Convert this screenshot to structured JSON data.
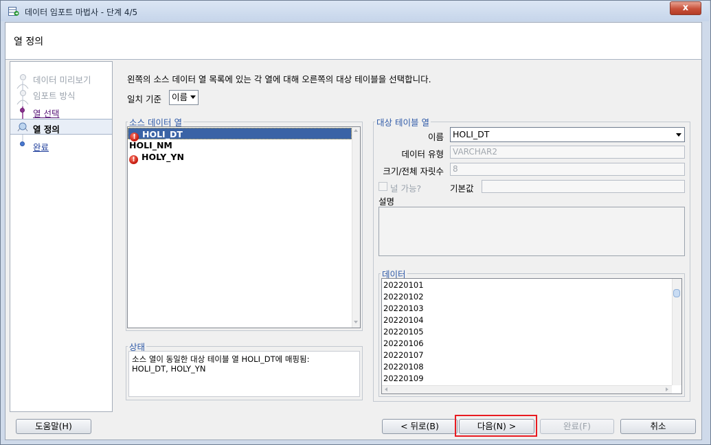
{
  "window": {
    "title": "데이터 임포트 마법사 - 단계 4/5",
    "close_glyph": "x"
  },
  "header": {
    "title": "열 정의"
  },
  "nav": {
    "items": [
      {
        "label": "데이터 미리보기",
        "state": "done"
      },
      {
        "label": "임포트 방식",
        "state": "done"
      },
      {
        "label": "열 선택",
        "state": "link"
      },
      {
        "label": "열 정의",
        "state": "current"
      },
      {
        "label": "완료",
        "state": "link"
      }
    ]
  },
  "main": {
    "instruction": "왼쪽의 소스 데이터 열 목록에 있는 각 열에 대해 오른쪽의 대상 테이블을 선택합니다.",
    "match_label": "일치 기준",
    "match_value": "이름"
  },
  "source": {
    "legend": "소스 데이터 열",
    "columns": [
      {
        "name": "HOLI_DT",
        "error": true,
        "selected": true
      },
      {
        "name": "HOLI_NM",
        "error": false,
        "selected": false
      },
      {
        "name": "HOLY_YN",
        "error": true,
        "selected": false
      }
    ]
  },
  "status": {
    "legend": "상태",
    "text_line1": "소스 열이 동일한 대상 테이블 열 HOLI_DT에 매핑됨:",
    "text_line2": "HOLI_DT, HOLY_YN"
  },
  "target": {
    "legend": "대상 테이블 열",
    "name_label": "이름",
    "name_value": "HOLI_DT",
    "type_label": "데이터 유형",
    "type_value": "VARCHAR2",
    "size_label": "크기/전체 자릿수",
    "size_value": "8",
    "nullable_label": "널 가능?",
    "default_label": "기본값",
    "default_value": "",
    "desc_label": "설명",
    "desc_value": ""
  },
  "data": {
    "legend": "데이터",
    "values": [
      "20220101",
      "20220102",
      "20220103",
      "20220104",
      "20220105",
      "20220106",
      "20220107",
      "20220108",
      "20220109"
    ]
  },
  "buttons": {
    "help": "도움말(H)",
    "back": "< 뒤로(B)",
    "next": "다음(N) >",
    "finish": "완료(F)",
    "cancel": "취소"
  },
  "colors": {
    "highlight": "#e81a20",
    "selection": "#3a63a6",
    "legend": "#2f5aa8"
  }
}
